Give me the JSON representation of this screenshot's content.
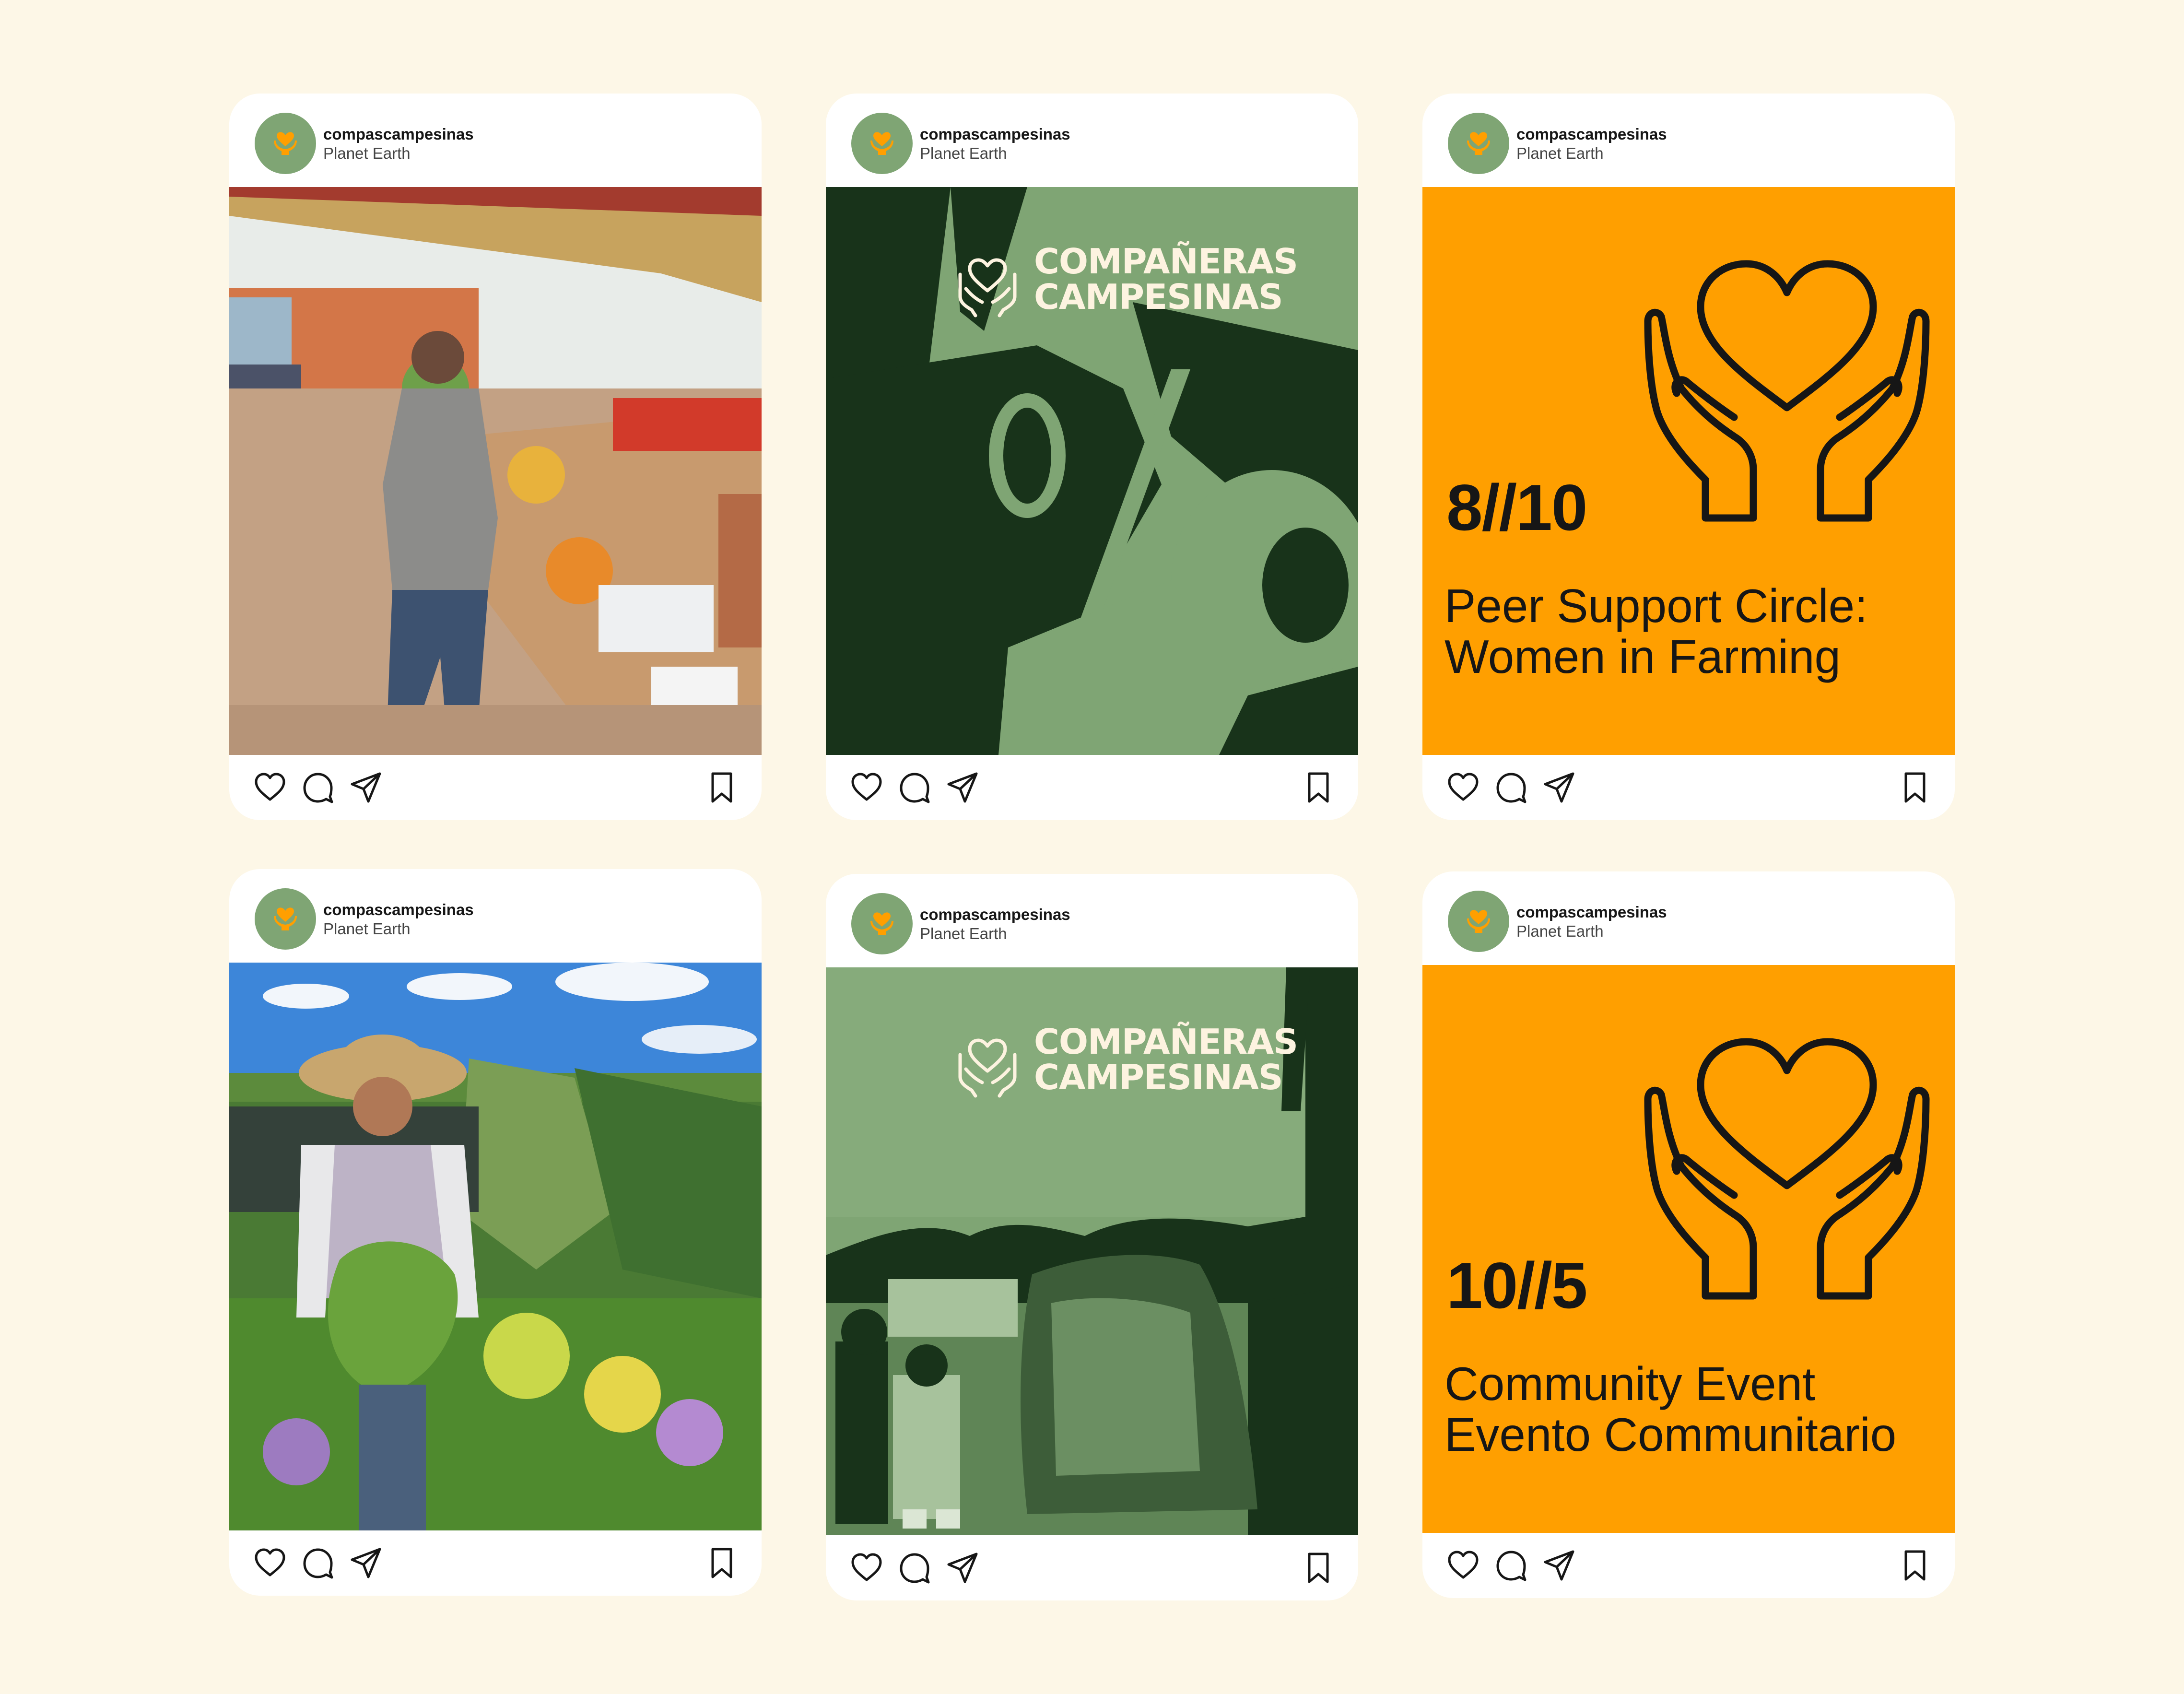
{
  "colors": {
    "background": "#fdf7e7",
    "brand_green": "#7fa574",
    "dark_green": "#18331a",
    "event_orange": "#ff9f00",
    "brand_icon": "#ff9f00"
  },
  "profile": {
    "username": "compascampesinas",
    "location": "Planet Earth"
  },
  "brand": {
    "line1": "COMPAÑERAS",
    "line2": "CAMPESINAS"
  },
  "posts": [
    {
      "kind": "photo",
      "scene": "woman preparing fruit at a farm stand"
    },
    {
      "kind": "brand",
      "scene": "duotone photo of harvested bananas"
    },
    {
      "kind": "event",
      "date": "8//10",
      "title_line1": "Peer Support Circle:",
      "title_line2": "Women in Farming"
    },
    {
      "kind": "photo",
      "scene": "woman in straw hat holding plants in a nursery"
    },
    {
      "kind": "brand",
      "scene": "duotone photo of people by a truck load"
    },
    {
      "kind": "event",
      "date": "10//5",
      "title_line1": "Community Event",
      "title_line2": "Evento Communitario"
    }
  ],
  "icons": {
    "like": "heart-icon",
    "comment": "comment-icon",
    "share": "send-icon",
    "save": "bookmark-icon",
    "logo": "heart-in-hands-icon"
  }
}
